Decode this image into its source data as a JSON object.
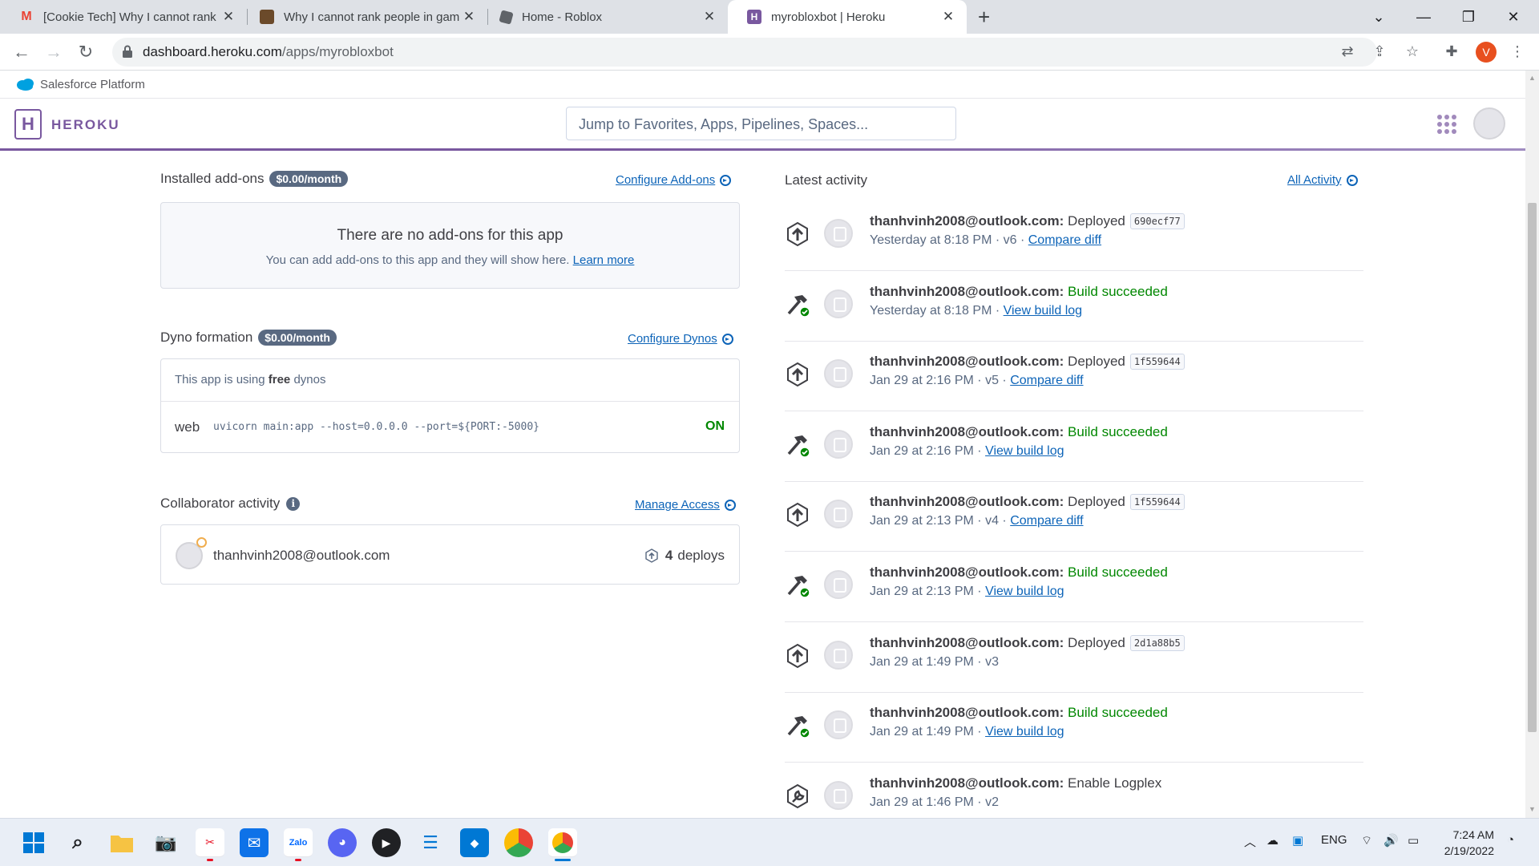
{
  "browser": {
    "tabs": [
      {
        "title": "[Cookie Tech] Why I cannot rank",
        "icon": "gmail-icon"
      },
      {
        "title": "Why I cannot rank people in gam",
        "icon": "roblox-game-icon"
      },
      {
        "title": "Home - Roblox",
        "icon": "roblox-icon"
      },
      {
        "title": "myrobloxbot | Heroku",
        "icon": "heroku-icon"
      }
    ],
    "url_host": "dashboard.heroku.com",
    "url_path": "/apps/myrobloxbot",
    "profile_initial": "V"
  },
  "salesforce_bar": {
    "label": "Salesforce Platform"
  },
  "header": {
    "brand": "HEROKU",
    "logo_glyph": "H",
    "search_placeholder": "Jump to Favorites, Apps, Pipelines, Spaces..."
  },
  "addons": {
    "title": "Installed add-ons",
    "price": "$0.00/month",
    "configure_link": "Configure Add-ons",
    "empty_title": "There are no add-ons for this app",
    "empty_text": "You can add add-ons to this app and they will show here.",
    "learn_more": "Learn more"
  },
  "dynos": {
    "title": "Dyno formation",
    "price": "$0.00/month",
    "configure_link": "Configure Dynos",
    "using_prefix": "This app is using",
    "using_type": "free",
    "using_suffix": "dynos",
    "process": "web",
    "command": "uvicorn main:app --host=0.0.0.0 --port=${PORT:-5000}",
    "state": "ON"
  },
  "collaborators": {
    "title": "Collaborator activity",
    "manage_link": "Manage Access",
    "email": "thanhvinh2008@outlook.com",
    "deploy_count": "4",
    "deploy_label": "deploys"
  },
  "activity": {
    "title": "Latest activity",
    "all_link": "All Activity",
    "items": [
      {
        "kind": "deploy",
        "user": "thanhvinh2008@outlook.com:",
        "action": "Deployed",
        "sha": "690ecf77",
        "time": "Yesterday at 8:18 PM",
        "version": "· v6 ·",
        "link": "Compare diff"
      },
      {
        "kind": "build",
        "user": "thanhvinh2008@outlook.com:",
        "action": "Build succeeded",
        "time": "Yesterday at 8:18 PM",
        "version": "·",
        "link": "View build log"
      },
      {
        "kind": "deploy",
        "user": "thanhvinh2008@outlook.com:",
        "action": "Deployed",
        "sha": "1f559644",
        "time": "Jan 29 at 2:16 PM",
        "version": "· v5 ·",
        "link": "Compare diff"
      },
      {
        "kind": "build",
        "user": "thanhvinh2008@outlook.com:",
        "action": "Build succeeded",
        "time": "Jan 29 at 2:16 PM",
        "version": "·",
        "link": "View build log"
      },
      {
        "kind": "deploy",
        "user": "thanhvinh2008@outlook.com:",
        "action": "Deployed",
        "sha": "1f559644",
        "time": "Jan 29 at 2:13 PM",
        "version": "· v4 ·",
        "link": "Compare diff"
      },
      {
        "kind": "build",
        "user": "thanhvinh2008@outlook.com:",
        "action": "Build succeeded",
        "time": "Jan 29 at 2:13 PM",
        "version": "·",
        "link": "View build log"
      },
      {
        "kind": "deploy",
        "user": "thanhvinh2008@outlook.com:",
        "action": "Deployed",
        "sha": "2d1a88b5",
        "time": "Jan 29 at 1:49 PM",
        "version": "· v3",
        "link": ""
      },
      {
        "kind": "build",
        "user": "thanhvinh2008@outlook.com:",
        "action": "Build succeeded",
        "time": "Jan 29 at 1:49 PM",
        "version": "·",
        "link": "View build log"
      },
      {
        "kind": "config",
        "user": "thanhvinh2008@outlook.com:",
        "action": "Enable Logplex",
        "time": "Jan 29 at 1:46 PM",
        "version": "· v2",
        "link": ""
      }
    ]
  },
  "taskbar": {
    "language": "ENG",
    "time": "7:24 AM",
    "date": "2/19/2022"
  },
  "colors": {
    "heroku_purple": "#79589f",
    "link_blue": "#0d64b8",
    "success_green": "#008700"
  }
}
